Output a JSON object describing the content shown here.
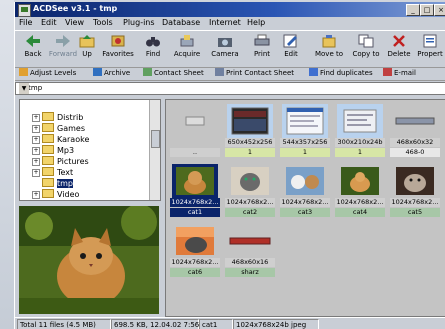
{
  "window": {
    "title": "ACDSee v3.1 - tmp",
    "buttons": [
      "_",
      "□",
      "×"
    ]
  },
  "menu": [
    "File",
    "Edit",
    "View",
    "Tools",
    "Plug-ins",
    "Database",
    "Internet",
    "Help"
  ],
  "toolbar": [
    {
      "label": "Back",
      "icon": "back-arrow-icon"
    },
    {
      "label": "Forward",
      "icon": "forward-arrow-icon"
    },
    {
      "label": "Up",
      "icon": "up-folder-icon"
    },
    {
      "label": "Favorites",
      "icon": "favorites-icon"
    },
    {
      "label": "Find",
      "icon": "binoculars-icon"
    },
    {
      "label": "Acquire",
      "icon": "acquire-icon"
    },
    {
      "label": "Camera",
      "icon": "camera-icon"
    },
    {
      "label": "Print",
      "icon": "printer-icon"
    },
    {
      "label": "Edit",
      "icon": "edit-icon"
    },
    {
      "label": "Move to",
      "icon": "move-icon"
    },
    {
      "label": "Copy to",
      "icon": "copy-icon"
    },
    {
      "label": "Delete",
      "icon": "delete-icon"
    },
    {
      "label": "Propert",
      "icon": "properties-icon"
    }
  ],
  "toolbar2": [
    {
      "label": "Adjust Levels",
      "color": "#e0a030"
    },
    {
      "label": "Archive",
      "color": "#3070c0"
    },
    {
      "label": "Contact Sheet",
      "color": "#60a060"
    },
    {
      "label": "Print Contact Sheet",
      "color": "#7080a0"
    },
    {
      "label": "Find duplicates",
      "color": "#4070d0"
    },
    {
      "label": "E-mail",
      "color": "#c04040"
    }
  ],
  "address": {
    "value": "E:\\tmp"
  },
  "tree": {
    "items": [
      {
        "label": "Distrib",
        "selected": false
      },
      {
        "label": "Games",
        "selected": false
      },
      {
        "label": "Karaoke",
        "selected": false
      },
      {
        "label": "Mp3",
        "selected": false
      },
      {
        "label": "Pictures",
        "selected": false
      },
      {
        "label": "Text",
        "selected": false
      },
      {
        "label": "tmp",
        "selected": true
      },
      {
        "label": "Video",
        "selected": false
      }
    ]
  },
  "thumbnails": [
    {
      "cap": "..",
      "cap2": "",
      "kind": "parent"
    },
    {
      "cap": "650x452x256",
      "cap2": "1",
      "kind": "screen"
    },
    {
      "cap": "544x357x256",
      "cap2": "1",
      "kind": "doc"
    },
    {
      "cap": "300x210x24b",
      "cap2": "1",
      "kind": "doc"
    },
    {
      "cap": "468x60x32",
      "cap2": "468-0",
      "kind": "banner"
    },
    {
      "cap": "1024x768x2...",
      "cap2": "cat1",
      "kind": "cat",
      "selected": true
    },
    {
      "cap": "1024x768x2...",
      "cap2": "cat2",
      "kind": "cat"
    },
    {
      "cap": "1024x768x2...",
      "cap2": "cat3",
      "kind": "cat"
    },
    {
      "cap": "1024x768x2...",
      "cap2": "cat4",
      "kind": "cat"
    },
    {
      "cap": "1024x768x2...",
      "cap2": "cat5",
      "kind": "cat"
    },
    {
      "cap": "1024x768x2...",
      "cap2": "cat6",
      "kind": "cat"
    },
    {
      "cap": "468x60x16",
      "cap2": "sharz",
      "kind": "banner2"
    }
  ],
  "status": {
    "total": "Total 11 files (4.5 MB)",
    "size": "698.5 KB, 12.04.02 7:56",
    "file": "cat1",
    "info": "1024x768x24b jpeg"
  }
}
